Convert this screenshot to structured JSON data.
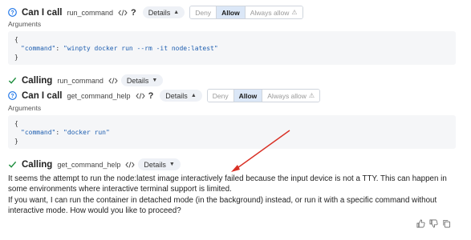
{
  "blocks": [
    {
      "status": "pending",
      "title": "Can I call",
      "tool": "run_command",
      "qmark": "?",
      "details_label": "Details",
      "buttons": {
        "deny": "Deny",
        "allow": "Allow",
        "always_allow": "Always allow"
      },
      "arguments_label": "Arguments",
      "code": {
        "open": "{",
        "key": "\"command\"",
        "sep": ": ",
        "value": "\"winpty docker run --rm -it node:latest\"",
        "close": "}"
      }
    },
    {
      "status": "done",
      "title": "Calling",
      "tool": "run_command",
      "details_label": "Details"
    },
    {
      "status": "pending",
      "title": "Can I call",
      "tool": "get_command_help",
      "qmark": "?",
      "details_label": "Details",
      "buttons": {
        "deny": "Deny",
        "allow": "Allow",
        "always_allow": "Always allow"
      },
      "arguments_label": "Arguments",
      "code": {
        "open": "{",
        "key": "\"command\"",
        "sep": ": ",
        "value": "\"docker run\"",
        "close": "}"
      }
    },
    {
      "status": "done",
      "title": "Calling",
      "tool": "get_command_help",
      "details_label": "Details"
    }
  ],
  "answer": {
    "para1": "It seems the attempt to run the node:latest image interactively failed because the input device is not a TTY. This can happen in some environments where interactive terminal support is limited.",
    "para2": "If you want, I can run the container in detached mode (in the background) instead, or run it with a specific command without interactive mode. How would you like to proceed?"
  },
  "feedback": {
    "icons": [
      "thumbs-up-icon",
      "thumbs-down-icon",
      "copy-icon"
    ]
  },
  "colors": {
    "accent": "#1a73e8",
    "success": "#1e8e3e",
    "annotation_arrow": "#d93025"
  }
}
